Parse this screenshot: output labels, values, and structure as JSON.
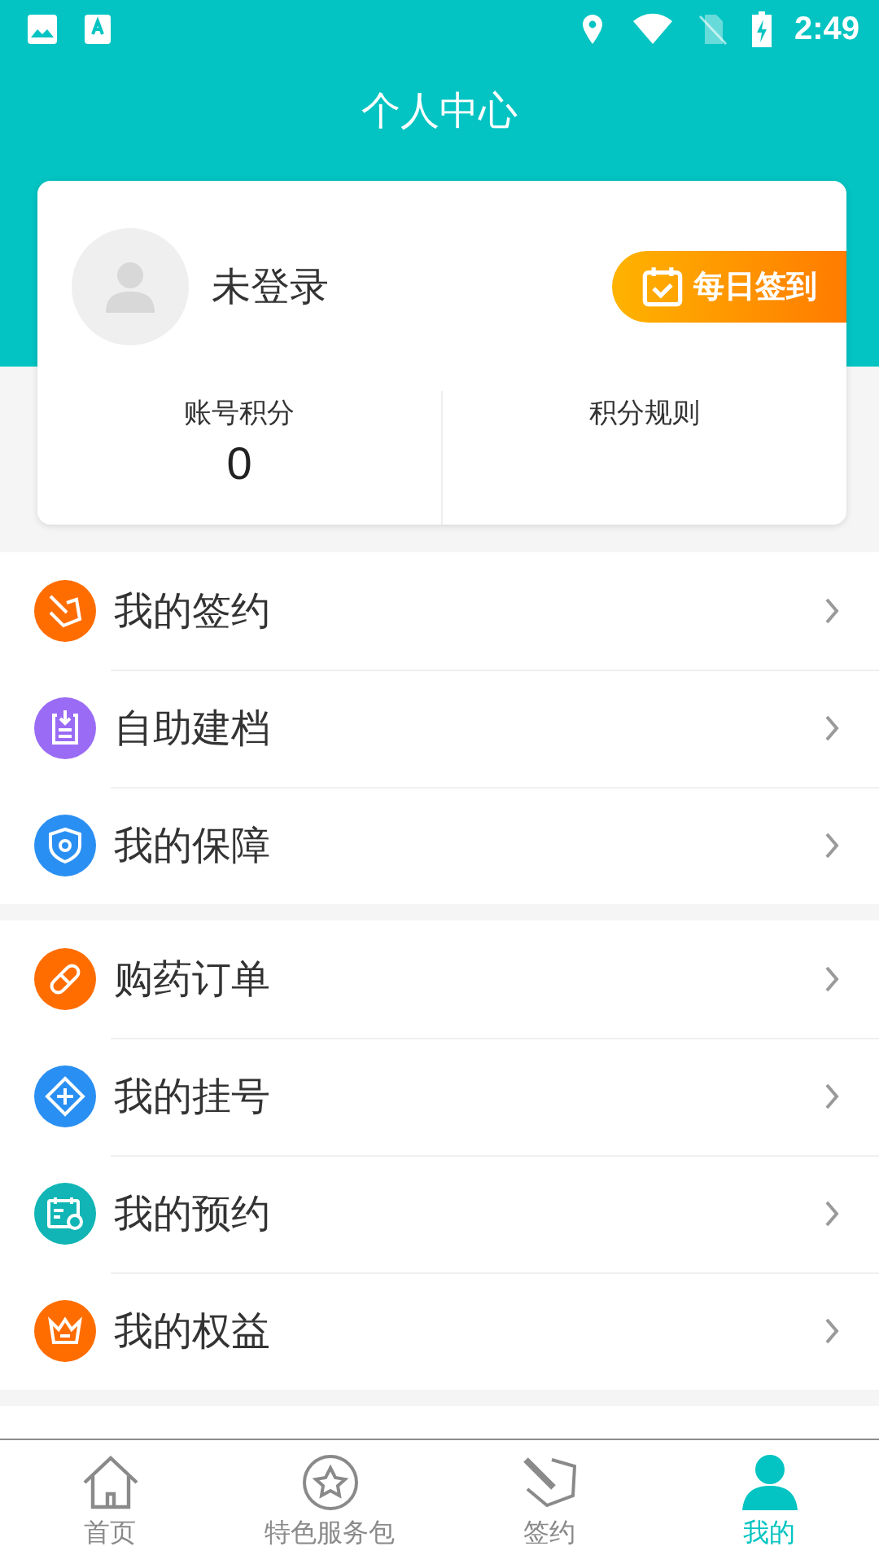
{
  "status_bar": {
    "time": "2:49"
  },
  "header": {
    "title": "个人中心"
  },
  "profile": {
    "name": "未登录",
    "checkin_button": "每日签到"
  },
  "stats": [
    {
      "label": "账号积分",
      "value": "0"
    },
    {
      "label": "积分规则"
    }
  ],
  "menu_groups": [
    [
      {
        "label": "我的签约",
        "kind": "sign",
        "color": "#ff6d00"
      },
      {
        "label": "自助建档",
        "kind": "archive",
        "color": "#9a6cf5"
      },
      {
        "label": "我的保障",
        "kind": "shield",
        "color": "#2a8ff2"
      }
    ],
    [
      {
        "label": "购药订单",
        "kind": "pill",
        "color": "#ff6d00"
      },
      {
        "label": "我的挂号",
        "kind": "register",
        "color": "#2a8ff2"
      },
      {
        "label": "我的预约",
        "kind": "calendar",
        "color": "#11b5b5"
      },
      {
        "label": "我的权益",
        "kind": "crown",
        "color": "#ff6d00"
      }
    ]
  ],
  "tab_bar": [
    {
      "label": "首页",
      "kind": "home",
      "selected": false
    },
    {
      "label": "特色服务包",
      "kind": "star",
      "selected": false
    },
    {
      "label": "签约",
      "kind": "sign",
      "selected": false
    },
    {
      "label": "我的",
      "kind": "person",
      "selected": true
    }
  ]
}
